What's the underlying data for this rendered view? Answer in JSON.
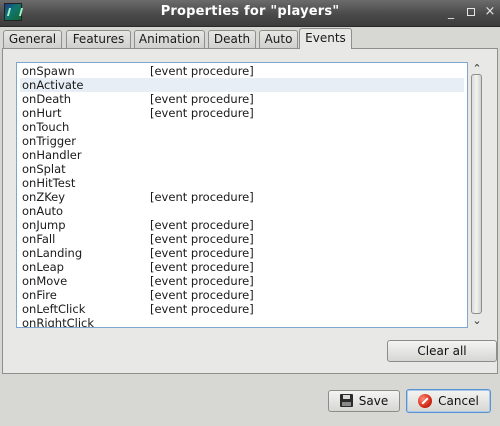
{
  "window": {
    "title": "Properties for \"players\"",
    "minimize_glyph": "_",
    "close_glyph": "×"
  },
  "tabs": [
    {
      "label": "General",
      "active": false
    },
    {
      "label": "Features",
      "active": false
    },
    {
      "label": "Animation",
      "active": false
    },
    {
      "label": "Death",
      "active": false
    },
    {
      "label": "Auto",
      "active": false
    },
    {
      "label": "Events",
      "active": true
    }
  ],
  "events": [
    {
      "name": "onSpawn",
      "value": "[event procedure]"
    },
    {
      "name": "onActivate",
      "value": ""
    },
    {
      "name": "onDeath",
      "value": "[event procedure]"
    },
    {
      "name": "onHurt",
      "value": "[event procedure]"
    },
    {
      "name": "onTouch",
      "value": ""
    },
    {
      "name": "onTrigger",
      "value": ""
    },
    {
      "name": "onHandler",
      "value": ""
    },
    {
      "name": "onSplat",
      "value": ""
    },
    {
      "name": "onHitTest",
      "value": ""
    },
    {
      "name": "onZKey",
      "value": "[event procedure]"
    },
    {
      "name": "onAuto",
      "value": ""
    },
    {
      "name": "onJump",
      "value": "[event procedure]"
    },
    {
      "name": "onFall",
      "value": "[event procedure]"
    },
    {
      "name": "onLanding",
      "value": "[event procedure]"
    },
    {
      "name": "onLeap",
      "value": "[event procedure]"
    },
    {
      "name": "onMove",
      "value": "[event procedure]"
    },
    {
      "name": "onFire",
      "value": "[event procedure]"
    },
    {
      "name": "onLeftClick",
      "value": "[event procedure]"
    },
    {
      "name": "onRightClick",
      "value": ""
    }
  ],
  "selected_event_index": 1,
  "buttons": {
    "clear_all": "Clear all",
    "save": "Save",
    "cancel": "Cancel"
  },
  "colors": {
    "selection": "#e7eef6",
    "list_border": "#7fa6cc"
  }
}
